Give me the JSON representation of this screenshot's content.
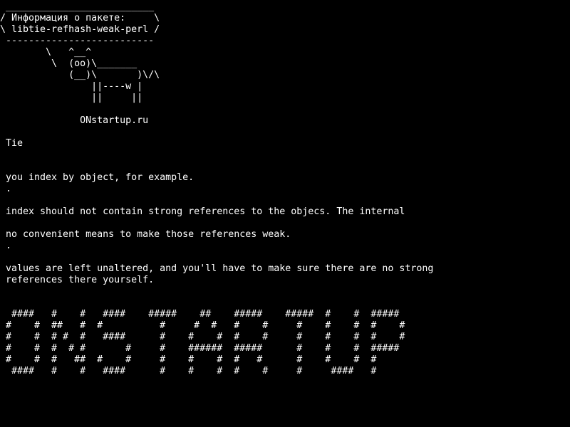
{
  "terminal": {
    "colors": {
      "background": "#000000",
      "foreground": "#ffffff"
    },
    "cowsay": {
      "bubble_top": " __________________________",
      "bubble_line1": "/ Информация о пакете:     \\",
      "bubble_line2": "\\ libtie-refhash-weak-perl /",
      "bubble_bottom": " --------------------------",
      "cow_line1": "        \\   ^__^",
      "cow_line2": "         \\  (oo)\\_______",
      "cow_line3": "            (__)\\       )\\/\\",
      "cow_line4": "                ||----w |",
      "cow_line5": "                ||     ||",
      "blank": "",
      "site": "              ONstartup.ru"
    },
    "description": {
      "title": " Tie",
      "line1": " you index by object, for example.",
      "dot1": " .",
      "line2": " index should not contain strong references to the objecs. The internal",
      "line3": " no convenient means to make those references weak.",
      "dot2": " .",
      "line4": " values are left unaltered, and you'll have to make sure there are no strong",
      "line5": " references there yourself."
    },
    "banner": {
      "row1": "  ####   #    #   ####    #####    ##    #####    #####  #    #  #####",
      "row2": " #    #  ##   #  #          #     #  #   #    #     #    #    #  #    #",
      "row3": " #    #  # #  #   ####      #    #    #  #    #     #    #    #  #    #",
      "row4": " #    #  #  # #       #     #    ######  #####      #    #    #  #####",
      "row5": " #    #  #   ##  #    #     #    #    #  #   #      #    #    #  #",
      "row6": "  ####   #    #   ####      #    #    #  #    #     #     ####   #"
    }
  }
}
